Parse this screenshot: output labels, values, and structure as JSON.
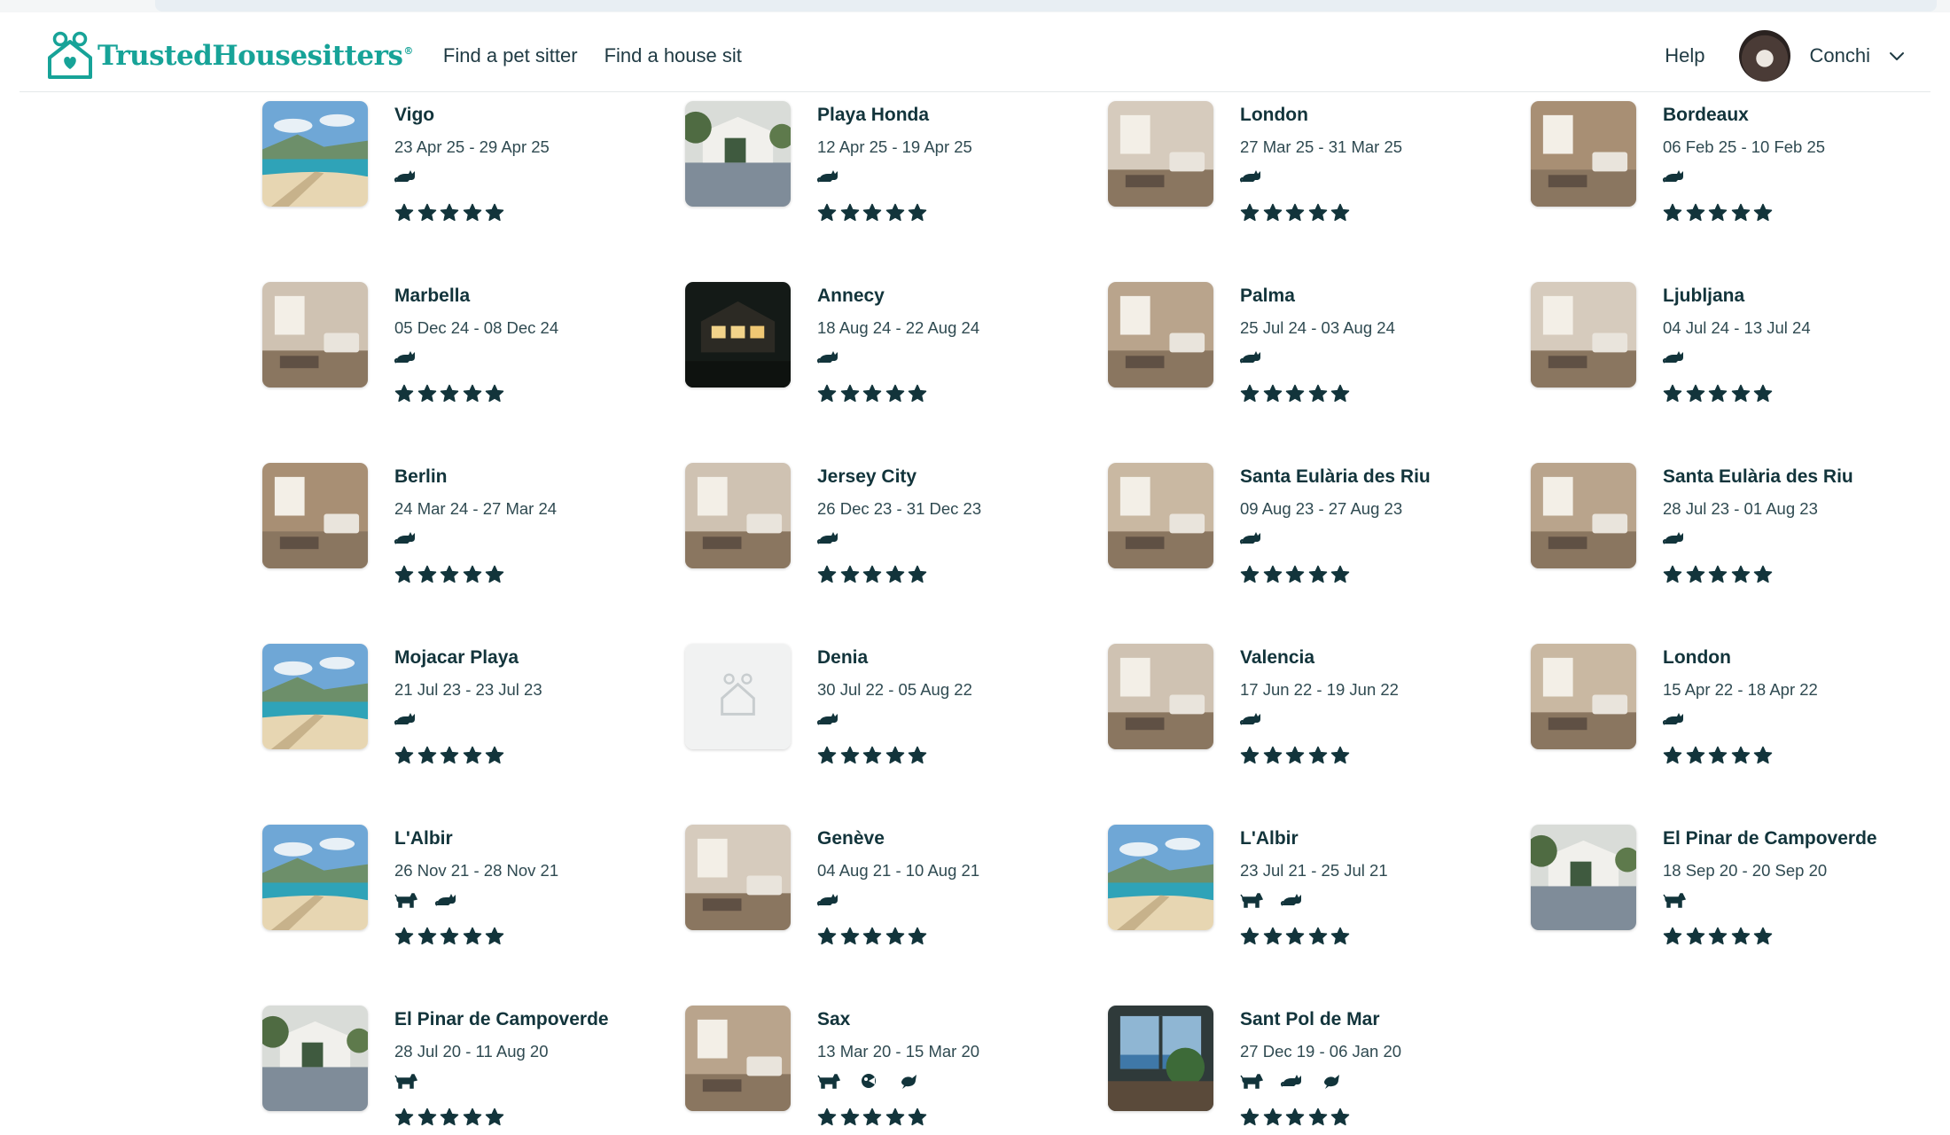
{
  "nav": {
    "brand": "TrustedHousesitters",
    "trademark": "®",
    "links": [
      "Find a pet sitter",
      "Find a house sit"
    ],
    "help": "Help",
    "user_name": "Conchi"
  },
  "colors": {
    "brand_teal": "#17a398",
    "text_dark": "#12343b",
    "icon_dark": "#12343b"
  },
  "sits": [
    {
      "city": "Vigo",
      "dates": "23 Apr 25 - 29 Apr 25",
      "pets": [
        "cat-icon"
      ],
      "rating": 5,
      "photo": "beach-icon"
    },
    {
      "city": "Playa Honda",
      "dates": "12 Apr 25 - 19 Apr 25",
      "pets": [
        "cat-icon"
      ],
      "rating": 5,
      "photo": "house-icon"
    },
    {
      "city": "London",
      "dates": "27 Mar 25 - 31 Mar 25",
      "pets": [
        "cat-icon"
      ],
      "rating": 5,
      "photo": "room-icon"
    },
    {
      "city": "Bordeaux",
      "dates": "06 Feb 25 - 10 Feb 25",
      "pets": [
        "cat-icon"
      ],
      "rating": 5,
      "photo": "room-icon"
    },
    {
      "city": "Marbella",
      "dates": "05 Dec 24 - 08 Dec 24",
      "pets": [
        "cat-icon"
      ],
      "rating": 5,
      "photo": "room-icon"
    },
    {
      "city": "Annecy",
      "dates": "18 Aug 24 - 22 Aug 24",
      "pets": [
        "cat-icon"
      ],
      "rating": 5,
      "photo": "night-house-icon"
    },
    {
      "city": "Palma",
      "dates": "25 Jul 24 - 03 Aug 24",
      "pets": [
        "cat-icon"
      ],
      "rating": 5,
      "photo": "room-icon"
    },
    {
      "city": "Ljubljana",
      "dates": "04 Jul 24 - 13 Jul 24",
      "pets": [
        "cat-icon"
      ],
      "rating": 5,
      "photo": "room-icon"
    },
    {
      "city": "Berlin",
      "dates": "24 Mar 24 - 27 Mar 24",
      "pets": [
        "cat-icon"
      ],
      "rating": 5,
      "photo": "room-icon"
    },
    {
      "city": "Jersey City",
      "dates": "26 Dec 23 - 31 Dec 23",
      "pets": [
        "cat-icon"
      ],
      "rating": 5,
      "photo": "room-icon"
    },
    {
      "city": "Santa Eulària des Riu",
      "dates": "09 Aug 23 - 27 Aug 23",
      "pets": [
        "cat-icon"
      ],
      "rating": 5,
      "photo": "room-icon"
    },
    {
      "city": "Santa Eulària des Riu",
      "dates": "28 Jul 23 - 01 Aug 23",
      "pets": [
        "cat-icon"
      ],
      "rating": 5,
      "photo": "room-icon"
    },
    {
      "city": "Mojacar Playa",
      "dates": "21 Jul 23 - 23 Jul 23",
      "pets": [
        "cat-icon"
      ],
      "rating": 5,
      "photo": "beach-icon"
    },
    {
      "city": "Denia",
      "dates": "30 Jul 22 - 05 Aug 22",
      "pets": [
        "cat-icon"
      ],
      "rating": 5,
      "photo": "placeholder-house-icon"
    },
    {
      "city": "Valencia",
      "dates": "17 Jun 22 - 19 Jun 22",
      "pets": [
        "cat-icon"
      ],
      "rating": 5,
      "photo": "room-icon"
    },
    {
      "city": "London",
      "dates": "15 Apr 22 - 18 Apr 22",
      "pets": [
        "cat-icon"
      ],
      "rating": 5,
      "photo": "room-icon"
    },
    {
      "city": "L'Albir",
      "dates": "26 Nov 21 - 28 Nov 21",
      "pets": [
        "dog-icon",
        "cat-icon"
      ],
      "rating": 5,
      "photo": "beach-icon"
    },
    {
      "city": "Genève",
      "dates": "04 Aug 21 - 10 Aug 21",
      "pets": [
        "cat-icon"
      ],
      "rating": 5,
      "photo": "room-icon"
    },
    {
      "city": "L'Albir",
      "dates": "23 Jul 21 - 25 Jul 21",
      "pets": [
        "dog-icon",
        "cat-icon"
      ],
      "rating": 5,
      "photo": "beach-icon"
    },
    {
      "city": "El Pinar de Campoverde",
      "dates": "18 Sep 20 - 20 Sep 20",
      "pets": [
        "dog-icon"
      ],
      "rating": 5,
      "photo": "house-icon"
    },
    {
      "city": "El Pinar de Campoverde",
      "dates": "28 Jul 20 - 11 Aug 20",
      "pets": [
        "dog-icon"
      ],
      "rating": 5,
      "photo": "house-icon"
    },
    {
      "city": "Sax",
      "dates": "13 Mar 20 - 15 Mar 20",
      "pets": [
        "dog-icon",
        "fish-icon",
        "bird-icon"
      ],
      "rating": 5,
      "photo": "room-icon"
    },
    {
      "city": "Sant Pol de Mar",
      "dates": "27 Dec 19 - 06 Jan 20",
      "pets": [
        "dog-icon",
        "cat-icon",
        "bird-icon"
      ],
      "rating": 5,
      "photo": "view-icon"
    }
  ]
}
